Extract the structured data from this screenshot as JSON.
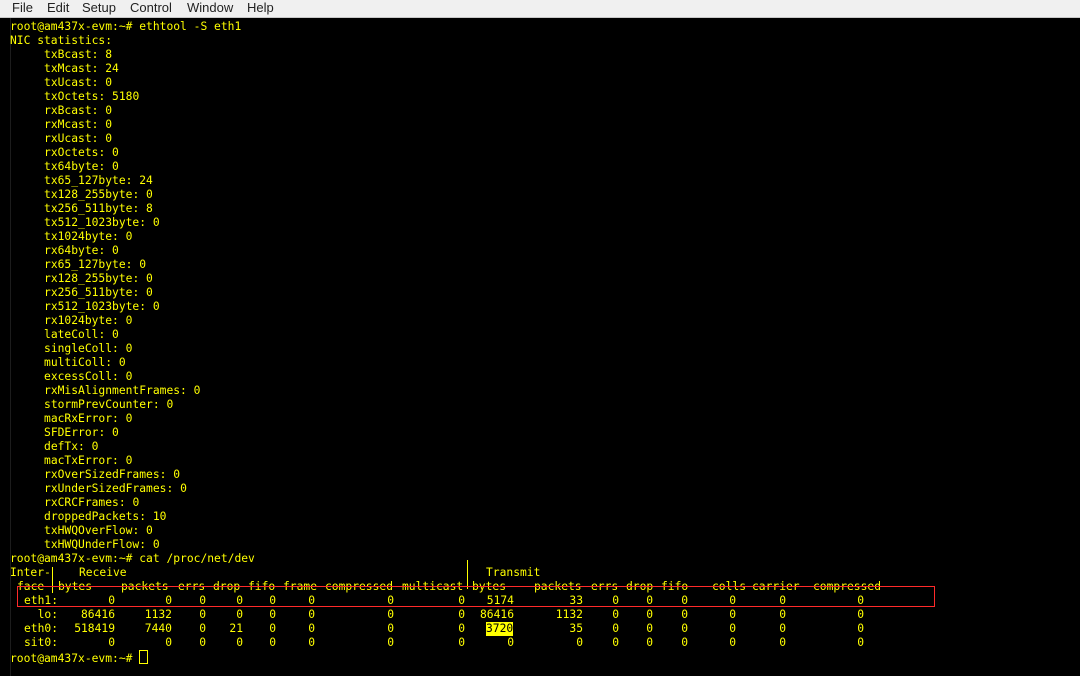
{
  "menu": [
    "File",
    "Edit",
    "Setup",
    "Control",
    "Window",
    "Help"
  ],
  "prompt": "root@am437x-evm:~#",
  "cmd1": " ethtool -S eth1",
  "stats_header": "NIC statistics:",
  "stats": [
    {
      "label": "txBcast",
      "value": "8"
    },
    {
      "label": "txMcast",
      "value": "24"
    },
    {
      "label": "txUcast",
      "value": "0"
    },
    {
      "label": "txOctets",
      "value": "5180"
    },
    {
      "label": "rxBcast",
      "value": "0"
    },
    {
      "label": "rxMcast",
      "value": "0"
    },
    {
      "label": "rxUcast",
      "value": "0"
    },
    {
      "label": "rxOctets",
      "value": "0"
    },
    {
      "label": "tx64byte",
      "value": "0"
    },
    {
      "label": "tx65_127byte",
      "value": "24"
    },
    {
      "label": "tx128_255byte",
      "value": "0"
    },
    {
      "label": "tx256_511byte",
      "value": "8"
    },
    {
      "label": "tx512_1023byte",
      "value": "0"
    },
    {
      "label": "tx1024byte",
      "value": "0"
    },
    {
      "label": "rx64byte",
      "value": "0"
    },
    {
      "label": "rx65_127byte",
      "value": "0"
    },
    {
      "label": "rx128_255byte",
      "value": "0"
    },
    {
      "label": "rx256_511byte",
      "value": "0"
    },
    {
      "label": "rx512_1023byte",
      "value": "0"
    },
    {
      "label": "rx1024byte",
      "value": "0"
    },
    {
      "label": "lateColl",
      "value": "0"
    },
    {
      "label": "singleColl",
      "value": "0"
    },
    {
      "label": "multiColl",
      "value": "0"
    },
    {
      "label": "excessColl",
      "value": "0"
    },
    {
      "label": "rxMisAlignmentFrames",
      "value": "0"
    },
    {
      "label": "stormPrevCounter",
      "value": "0"
    },
    {
      "label": "macRxError",
      "value": "0"
    },
    {
      "label": "SFDError",
      "value": "0"
    },
    {
      "label": "defTx",
      "value": "0"
    },
    {
      "label": "macTxError",
      "value": "0"
    },
    {
      "label": "rxOverSizedFrames",
      "value": "0"
    },
    {
      "label": "rxUnderSizedFrames",
      "value": "0"
    },
    {
      "label": "rxCRCFrames",
      "value": "0"
    },
    {
      "label": "droppedPackets",
      "value": "10"
    },
    {
      "label": "txHWQOverFlow",
      "value": "0"
    },
    {
      "label": "txHWQUnderFlow",
      "value": "0"
    }
  ],
  "cmd2": " cat /proc/net/dev",
  "dev_header1": {
    "inter": "Inter-",
    "receive": "Receive",
    "transmit": "Transmit"
  },
  "dev_header2": [
    "face",
    "bytes",
    "packets",
    "errs",
    "drop",
    "fifo",
    "frame",
    "compressed",
    "multicast",
    "bytes",
    "packets",
    "errs",
    "drop",
    "fifo",
    "colls",
    "carrier",
    "compressed"
  ],
  "dev_rows": [
    {
      "iface": "eth1:",
      "values": [
        "0",
        "0",
        "0",
        "0",
        "0",
        "0",
        "0",
        "0",
        "5174",
        "33",
        "0",
        "0",
        "0",
        "0",
        "0",
        "0"
      ]
    },
    {
      "iface": "lo:",
      "values": [
        "86416",
        "1132",
        "0",
        "0",
        "0",
        "0",
        "0",
        "0",
        "86416",
        "1132",
        "0",
        "0",
        "0",
        "0",
        "0",
        "0"
      ]
    },
    {
      "iface": "eth0:",
      "values": [
        "518419",
        "7440",
        "0",
        "21",
        "0",
        "0",
        "0",
        "0",
        "3720",
        "35",
        "0",
        "0",
        "0",
        "0",
        "0",
        "0"
      ]
    },
    {
      "iface": "sit0:",
      "values": [
        "0",
        "0",
        "0",
        "0",
        "0",
        "0",
        "0",
        "0",
        "0",
        "0",
        "0",
        "0",
        "0",
        "0",
        "0",
        "0"
      ]
    }
  ],
  "colors": {
    "text": "#ffff00",
    "background": "#000000",
    "box": "#ff2a2a"
  }
}
